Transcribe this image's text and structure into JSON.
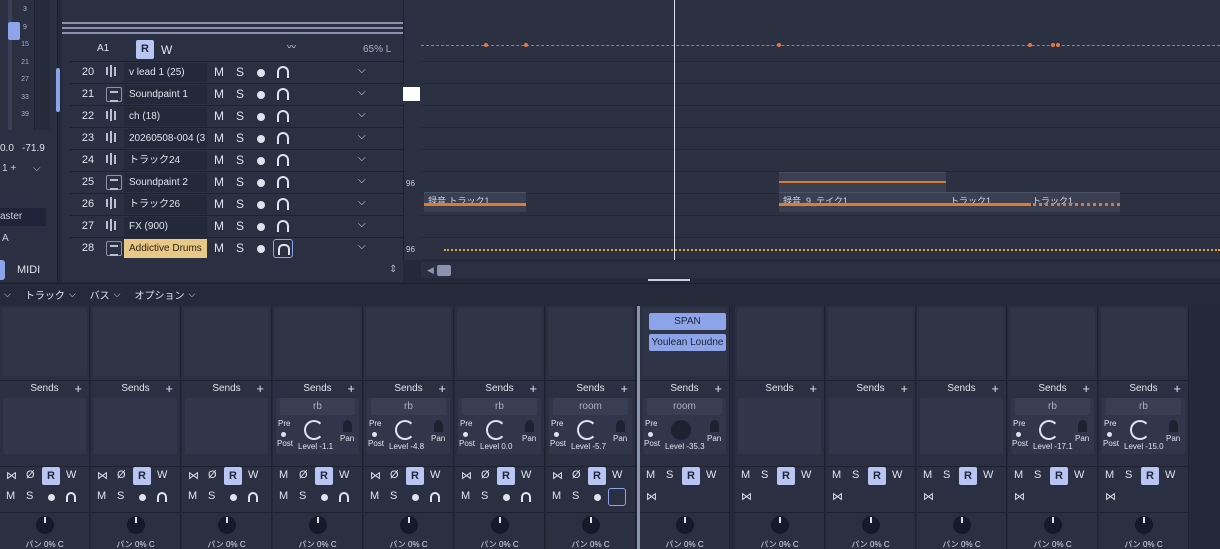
{
  "meter": {
    "scale": [
      "3",
      "9",
      "15",
      "21",
      "27",
      "33",
      "39"
    ],
    "value_left": "0.0",
    "value_right": "-71.9",
    "input_label": "1 +",
    "output_label": "aster",
    "automation_label": "A",
    "midi_tab": "MIDI"
  },
  "header": {
    "track_slot": "A1",
    "read_label": "R",
    "write_label": "W",
    "volume": "65% L"
  },
  "tracks": [
    {
      "num": "20",
      "name": "v lead 1 (25)",
      "type": "audio",
      "m": "M",
      "s": "S"
    },
    {
      "num": "21",
      "name": "Soundpaint 1",
      "type": "instrument",
      "m": "M",
      "s": "S"
    },
    {
      "num": "22",
      "name": "ch (18)",
      "type": "audio",
      "m": "M",
      "s": "S"
    },
    {
      "num": "23",
      "name": "20260508-004 (3",
      "type": "audio",
      "m": "M",
      "s": "S"
    },
    {
      "num": "24",
      "name": "トラック24",
      "type": "audio",
      "m": "M",
      "s": "S"
    },
    {
      "num": "25",
      "name": "Soundpaint 2",
      "type": "instrument",
      "m": "M",
      "s": "S"
    },
    {
      "num": "26",
      "name": "トラック26",
      "type": "audio",
      "m": "M",
      "s": "S"
    },
    {
      "num": "27",
      "name": "FX (900)",
      "type": "audio",
      "m": "M",
      "s": "S"
    },
    {
      "num": "28",
      "name": "Addictive Drums",
      "type": "instrument",
      "m": "M",
      "s": "S",
      "selected": true
    }
  ],
  "ruler": {
    "mark_a": "96",
    "mark_b": "96"
  },
  "clips": {
    "lane26_a": "録音 トラック1",
    "lane26_b": "録音_9_テイク1",
    "lane26_c": "トラック1",
    "lane26_d": "トラック1"
  },
  "mixer_menu": [
    {
      "label": "トラック"
    },
    {
      "label": "バス"
    },
    {
      "label": "オプション"
    }
  ],
  "strips": [
    {
      "sends": "Sends",
      "send_name": "",
      "level": "",
      "pan": "パン 0% C",
      "row1": [
        "⋈",
        "Ø",
        "R",
        "W"
      ],
      "row2": [
        "M",
        "S"
      ],
      "plugins": []
    },
    {
      "sends": "Sends",
      "send_name": "",
      "level": "",
      "pan": "パン 0% C",
      "row1": [
        "⋈",
        "Ø",
        "R",
        "W"
      ],
      "row2": [
        "M",
        "S"
      ],
      "plugins": []
    },
    {
      "sends": "Sends",
      "send_name": "",
      "level": "",
      "pan": "パン 0% C",
      "row1": [
        "⋈",
        "Ø",
        "R",
        "W"
      ],
      "row2": [
        "M",
        "S"
      ],
      "plugins": []
    },
    {
      "sends": "Sends",
      "send_name": "rb",
      "level": "Level -1.1",
      "pan": "パン 0% C",
      "row1": [
        "M",
        "Ø",
        "R",
        "W"
      ],
      "row2": [
        "M",
        "S"
      ],
      "plugins": []
    },
    {
      "sends": "Sends",
      "send_name": "rb",
      "level": "Level -4.8",
      "pan": "パン 0% C",
      "row1": [
        "⋈",
        "Ø",
        "R",
        "W"
      ],
      "row2": [
        "M",
        "S"
      ],
      "plugins": []
    },
    {
      "sends": "Sends",
      "send_name": "rb",
      "level": "Level 0.0",
      "pan": "パン 0% C",
      "row1": [
        "⋈",
        "Ø",
        "R",
        "W"
      ],
      "row2": [
        "M",
        "S"
      ],
      "plugins": []
    },
    {
      "sends": "Sends",
      "send_name": "room",
      "level": "Level -5.7",
      "pan": "パン 0% C",
      "row1": [
        "⋈",
        "Ø",
        "R",
        "W"
      ],
      "row2": [
        "M",
        "S"
      ],
      "plugins": []
    },
    {
      "sends": "Sends",
      "send_name": "room",
      "level": "Level -35.3",
      "pan": "パン 0% C",
      "row1": [
        "M",
        "S",
        "R",
        "W"
      ],
      "row2": [
        "⋈"
      ],
      "plugins": [
        "SPAN",
        "Youlean Loudne"
      ]
    },
    {
      "sends": "Sends",
      "send_name": "",
      "level": "",
      "pan": "パン 0% C",
      "row1": [
        "M",
        "S",
        "R",
        "W"
      ],
      "row2": [
        "⋈"
      ],
      "plugins": []
    },
    {
      "sends": "Sends",
      "send_name": "",
      "level": "",
      "pan": "パン 0% C",
      "row1": [
        "M",
        "S",
        "R",
        "W"
      ],
      "row2": [
        "⋈"
      ],
      "plugins": []
    },
    {
      "sends": "Sends",
      "send_name": "",
      "level": "",
      "pan": "パン 0% C",
      "row1": [
        "M",
        "S",
        "R",
        "W"
      ],
      "row2": [
        "⋈"
      ],
      "plugins": []
    },
    {
      "sends": "Sends",
      "send_name": "rb",
      "level": "Level -17.1",
      "pan": "パン 0% C",
      "row1": [
        "M",
        "S",
        "R",
        "W"
      ],
      "row2": [
        "⋈"
      ],
      "plugins": []
    },
    {
      "sends": "Sends",
      "send_name": "rb",
      "level": "Level -15.0",
      "pan": "パン 0% C",
      "row1": [
        "M",
        "S",
        "R",
        "W"
      ],
      "row2": [
        "⋈"
      ],
      "plugins": []
    }
  ],
  "labels": {
    "pre": "Pre",
    "post": "Post",
    "pan_short": "Pan"
  }
}
